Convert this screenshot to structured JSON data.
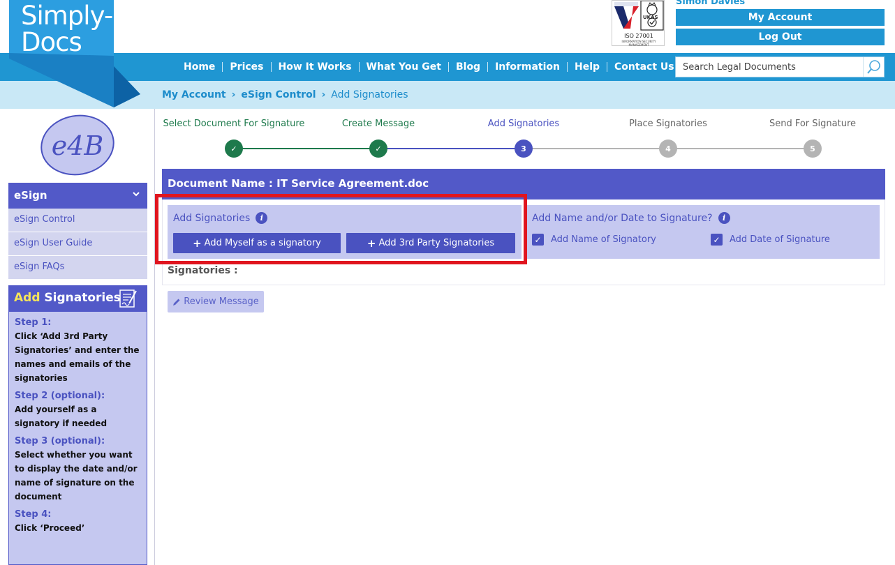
{
  "brand": {
    "logo_text_line1": "Simply-",
    "logo_text_line2": "Docs"
  },
  "certification": {
    "label": "ISO 27001",
    "sub": "INFORMATION SECURITY MANAGEMENT",
    "badge": "UKAS"
  },
  "user": {
    "name": "Simon Davies",
    "my_account": "My Account",
    "log_out": "Log Out"
  },
  "nav": {
    "items": [
      "Home",
      "Prices",
      "How It Works",
      "What You Get",
      "Blog",
      "Information",
      "Help",
      "Contact Us"
    ]
  },
  "search": {
    "placeholder": "Search Legal Documents",
    "icon": "search-icon"
  },
  "breadcrumb": {
    "items": [
      "My Account",
      "eSign Control"
    ],
    "current": "Add Signatories"
  },
  "sidebar": {
    "logo_text": "e4B",
    "section_title": "eSign",
    "links": [
      "eSign Control",
      "eSign User Guide",
      "eSign FAQs"
    ],
    "help_title_highlight": "Add",
    "help_title_rest": " Signatories",
    "steps": [
      {
        "title": "Step 1:",
        "desc": "Click ‘Add 3rd Party Signatories’ and enter the names and emails of the signatories"
      },
      {
        "title": "Step 2 (optional):",
        "desc": "Add yourself as a signatory if needed"
      },
      {
        "title": "Step 3 (optional):",
        "desc": "Select whether you want to display the date and/or name of signature on the document"
      },
      {
        "title": "Step 4:",
        "desc": "Click ‘Proceed’"
      }
    ]
  },
  "progress": {
    "steps": [
      {
        "label": "Select Document For Signature",
        "marker": "✓",
        "status": "done"
      },
      {
        "label": "Create Message",
        "marker": "✓",
        "status": "done"
      },
      {
        "label": "Add Signatories",
        "marker": "3",
        "status": "current"
      },
      {
        "label": "Place Signatories",
        "marker": "4",
        "status": "todo"
      },
      {
        "label": "Send For Signature",
        "marker": "5",
        "status": "todo"
      }
    ],
    "colors": {
      "done": "#1e7a4c",
      "current": "#4a52c0",
      "todo": "#b4b4b4"
    }
  },
  "document": {
    "heading": "Document Name : IT Service Agreement.doc",
    "add_signatories_title": "Add Signatories",
    "add_myself_button": "Add Myself as a signatory",
    "add_third_party_button": "Add 3rd Party Signatories",
    "options_title": "Add Name and/or Date to Signature?",
    "add_name_label": "Add Name of Signatory",
    "add_name_checked": true,
    "add_date_label": "Add Date of Signature",
    "add_date_checked": true,
    "signatories_label": "Signatories :",
    "review_button": "Review Message"
  },
  "colors": {
    "brand_blue": "#1f96d2",
    "purple": "#5259c8",
    "light_purple": "#c5c8f0",
    "highlight_red": "#e0151f"
  }
}
